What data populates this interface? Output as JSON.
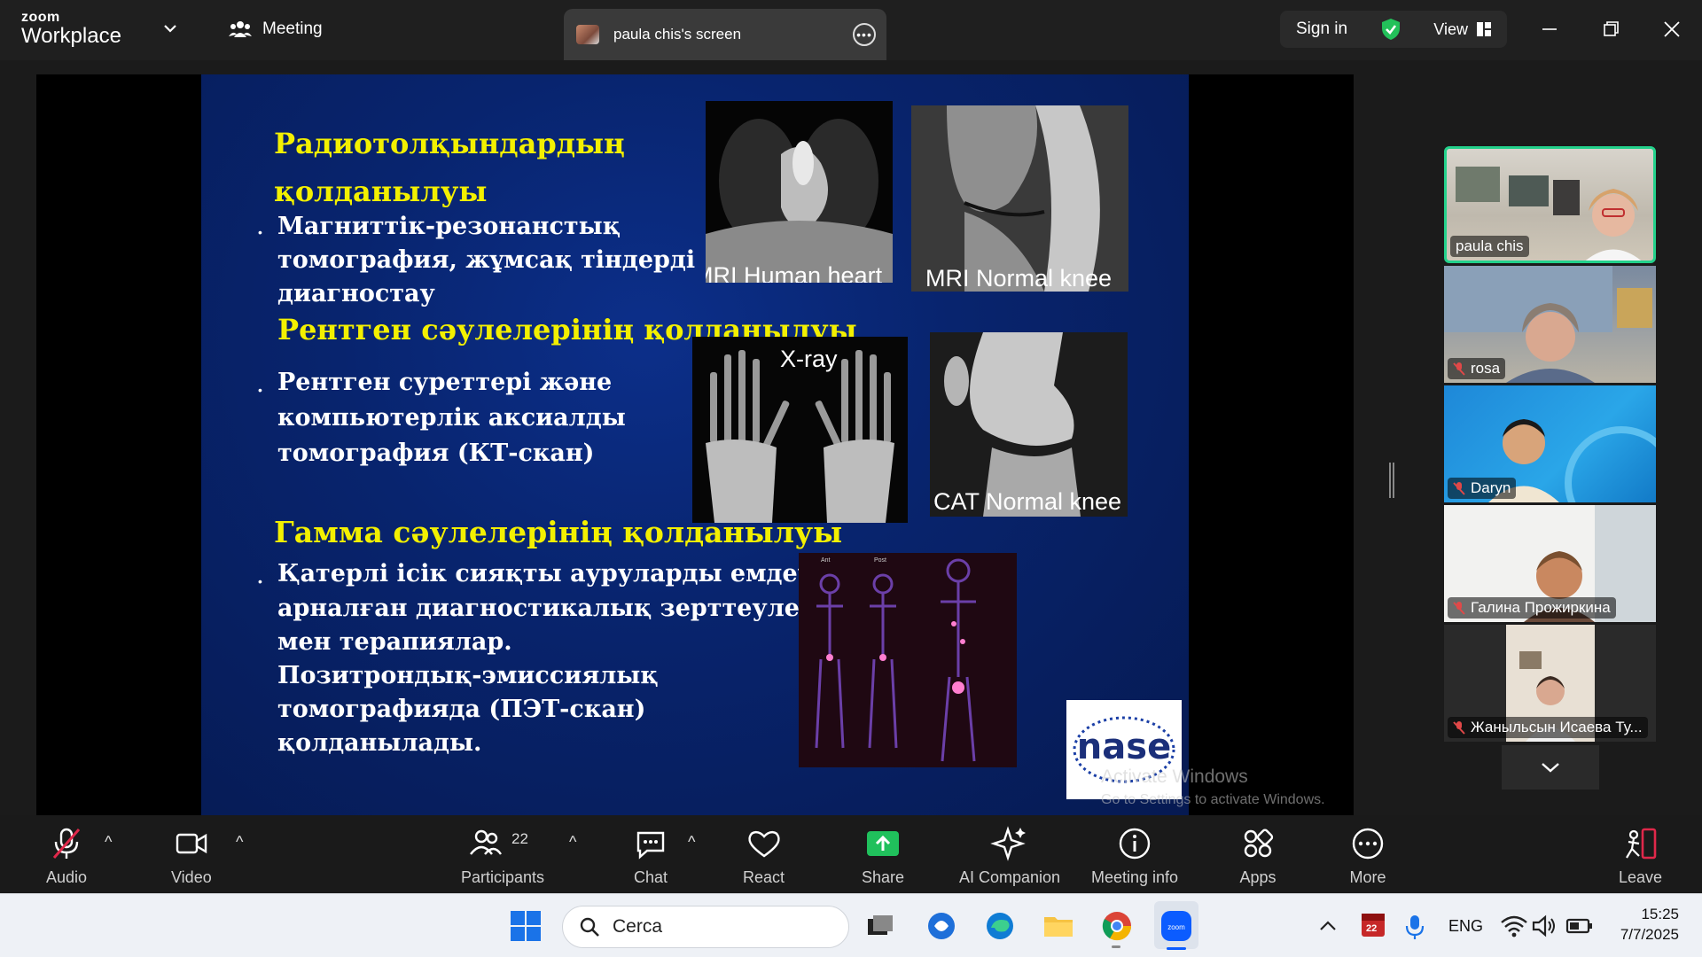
{
  "app": {
    "brand_top": "zoom",
    "brand_bottom": "Workplace"
  },
  "titlebar": {
    "meeting_tab": "Meeting",
    "screen_tab": "paula chis's screen",
    "sign_in": "Sign in",
    "view": "View"
  },
  "slide": {
    "heading1_line1": "Радиотолқындардың",
    "heading1_line2": "қолданылуы",
    "bullet1_lines": [
      "Магниттік-резонанстық",
      "томография, жұмсақ тіндерді",
      "диагностау"
    ],
    "heading2": "Рентген сәулелерінің қолданылуы",
    "bullet2_lines": [
      "Рентген суреттері және",
      "компьютерлік аксиалды",
      "томография (КТ-скан)"
    ],
    "heading3": "Гамма сәулелерінің қолданылуы",
    "bullet3_lines": [
      "Қатерлі ісік сияқты ауруларды емдеуге",
      "арналған диагностикалық зерттеулер",
      "мен терапиялар.",
      "Позитрондық-эмиссиялық",
      "томографияда (ПЭТ-скан)",
      "қолданылады."
    ],
    "captions": {
      "mri_heart": "MRI Human heart",
      "mri_knee": "MRI Normal knee",
      "xray": "X-ray",
      "cat_knee": "CAT Normal knee"
    },
    "pet_labels": [
      "Ant",
      "Post"
    ],
    "logo_text": "nase",
    "watermark_title": "Activate Windows",
    "watermark_sub": "Go to Settings to activate Windows."
  },
  "participants": [
    {
      "name": "paula chis",
      "muted": false,
      "active": true
    },
    {
      "name": "rosa",
      "muted": true,
      "active": false
    },
    {
      "name": "Daryn",
      "muted": true,
      "active": false
    },
    {
      "name": "Галина Прожиркина",
      "muted": true,
      "active": false
    },
    {
      "name": "Жаныльсын Исаева Ту...",
      "muted": true,
      "active": false
    }
  ],
  "toolbar": {
    "audio": "Audio",
    "video": "Video",
    "participants": "Participants",
    "participants_count": "22",
    "chat": "Chat",
    "react": "React",
    "share": "Share",
    "ai": "AI Companion",
    "info": "Meeting info",
    "apps": "Apps",
    "more": "More",
    "leave": "Leave"
  },
  "taskbar": {
    "search_placeholder": "Cerca",
    "calendar_badge": "22",
    "lang": "ENG",
    "time": "15:25",
    "date": "7/7/2025"
  },
  "colors": {
    "accent_green": "#23d18b",
    "slide_yellow": "#f3f000",
    "share_green": "#20c05c",
    "leave_red": "#e0284a"
  }
}
